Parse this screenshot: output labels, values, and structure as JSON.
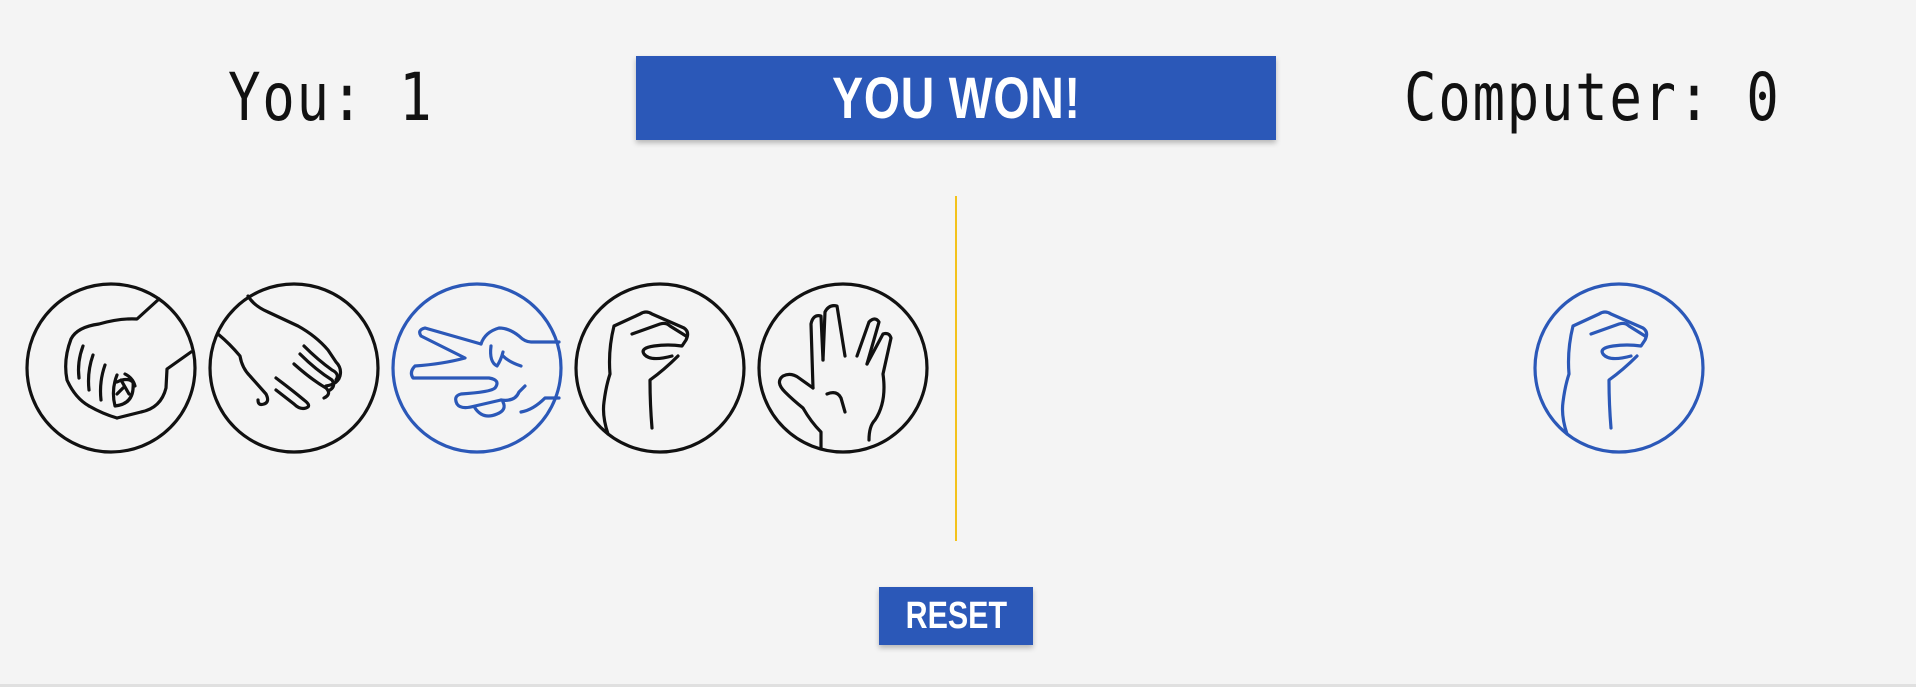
{
  "scoreboard": {
    "you_label": "You: 1",
    "computer_label": "Computer: 0"
  },
  "result": {
    "text": "YOU WON!"
  },
  "player_choices": [
    {
      "name": "rock",
      "icon": "rock-hand-icon",
      "selected": false
    },
    {
      "name": "paper",
      "icon": "paper-hand-icon",
      "selected": false
    },
    {
      "name": "scissors",
      "icon": "scissors-hand-icon",
      "selected": true
    },
    {
      "name": "lizard",
      "icon": "lizard-hand-icon",
      "selected": false
    },
    {
      "name": "spock",
      "icon": "spock-hand-icon",
      "selected": false
    }
  ],
  "computer_choice": {
    "name": "lizard",
    "icon": "lizard-hand-icon"
  },
  "controls": {
    "reset_label": "RESET"
  },
  "colors": {
    "background": "#f4f4f4",
    "accent_blue": "#2b58b8",
    "divider_yellow": "#f3c21b",
    "icon_default": "#111111",
    "icon_selected": "#2b58b8"
  }
}
